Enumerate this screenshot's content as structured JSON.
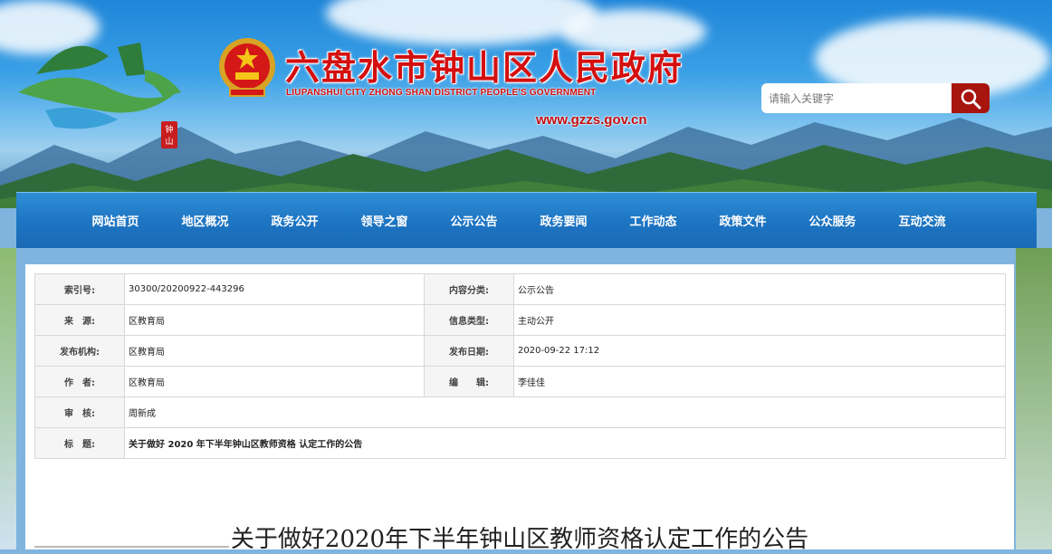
{
  "site": {
    "title": "六盘水市钟山区人民政府",
    "subtitle": "LIUPANSHUI CITY ZHONG SHAN DISTRICT PEOPLE'S GOVERNMENT",
    "url": "www.gzzs.gov.cn",
    "logo_text": "钟山"
  },
  "search": {
    "placeholder": "请输入关键字"
  },
  "nav": {
    "items": [
      "网站首页",
      "地区概况",
      "政务公开",
      "领导之窗",
      "公示公告",
      "政务要闻",
      "工作动态",
      "政策文件",
      "公众服务",
      "互动交流"
    ]
  },
  "meta": {
    "index_label": "索引号:",
    "index_value": "30300/20200922-443296",
    "category_label": "内容分类:",
    "category_value": "公示公告",
    "source_label": "来　源:",
    "source_value": "区教育局",
    "info_type_label": "信息类型:",
    "info_type_value": "主动公开",
    "publisher_label": "发布机构:",
    "publisher_value": "区教育局",
    "date_label": "发布日期:",
    "date_value": "2020-09-22 17:12",
    "author_label": "作　者:",
    "author_value": "区教育局",
    "editor_label": "编　　辑:",
    "editor_value": "李佳佳",
    "review_label": "审　核:",
    "review_value": "周新成",
    "title_label": "标　题:",
    "title_value": "关于做好 2020 年下半年钟山区教师资格 认定工作的公告"
  },
  "article": {
    "title": "关于做好2020年下半年钟山区教师资格认定工作的公告"
  },
  "colors": {
    "nav_blue": "#1d74c2",
    "title_red": "#d40f0f",
    "search_btn": "#a8150f"
  }
}
